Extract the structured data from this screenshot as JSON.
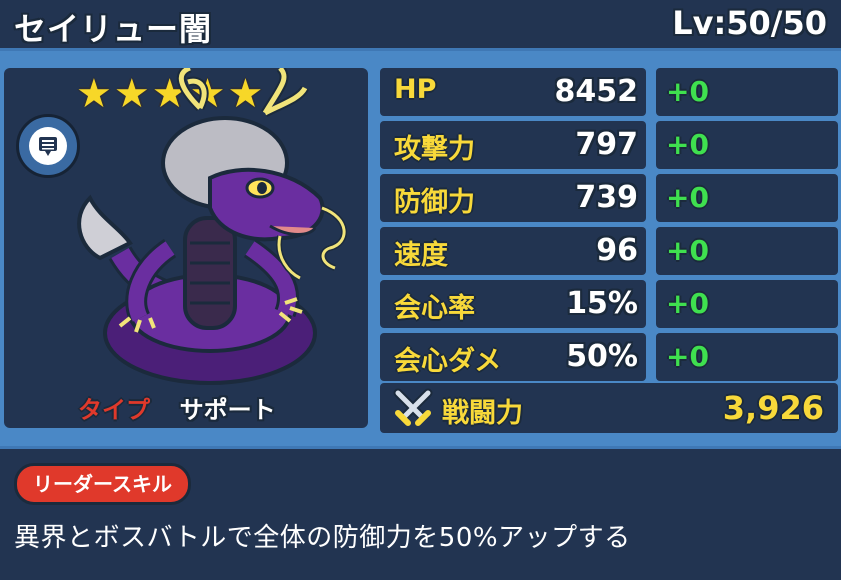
{
  "header": {
    "name": "セイリュー闇",
    "level": "Lv:50/50"
  },
  "character": {
    "rarity_stars": 5,
    "type_label": "タイプ",
    "type_value": "サポート"
  },
  "stats": [
    {
      "label": "HP",
      "value": "8452",
      "bonus": "+0"
    },
    {
      "label": "攻撃力",
      "value": "797",
      "bonus": "+0"
    },
    {
      "label": "防御力",
      "value": "739",
      "bonus": "+0"
    },
    {
      "label": "速度",
      "value": "96",
      "bonus": "+0"
    },
    {
      "label": "会心率",
      "value": "15%",
      "bonus": "+0"
    },
    {
      "label": "会心ダメ",
      "value": "50%",
      "bonus": "+0"
    }
  ],
  "power": {
    "label": "戦闘力",
    "value": "3,926"
  },
  "leader_skill": {
    "badge": "リーダースキル",
    "description": "異界とボスバトルで全体の防御力を50%アップする"
  },
  "colors": {
    "background": "#4a88c6",
    "panel": "#223451",
    "stat_label": "#f8d93a",
    "bonus": "#3fe04f",
    "type_label": "#e0392b",
    "skill_badge": "#e0392b",
    "monster_body": "#6a2ea0"
  },
  "icons": [
    "star-icon",
    "chat-bubble-icon",
    "crossed-swords-icon"
  ]
}
